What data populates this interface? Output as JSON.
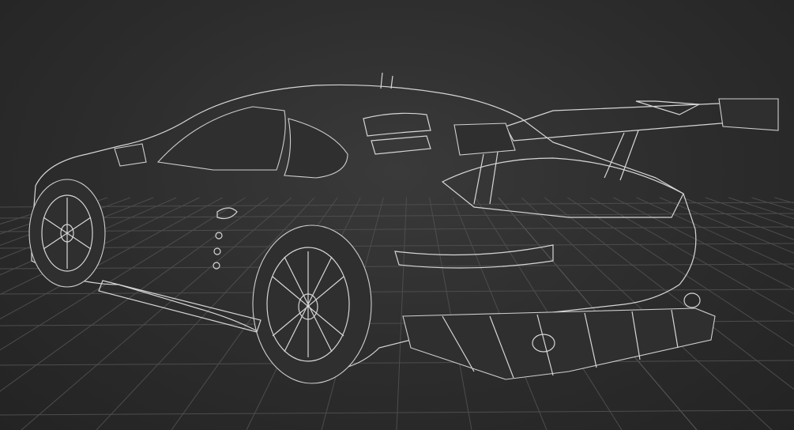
{
  "viewport": {
    "background": "#2a2a2a",
    "grid_color": "#4d4d4d",
    "wireframe_color": "#d6d6d6",
    "subject_icon": "race-car-wireframe"
  }
}
